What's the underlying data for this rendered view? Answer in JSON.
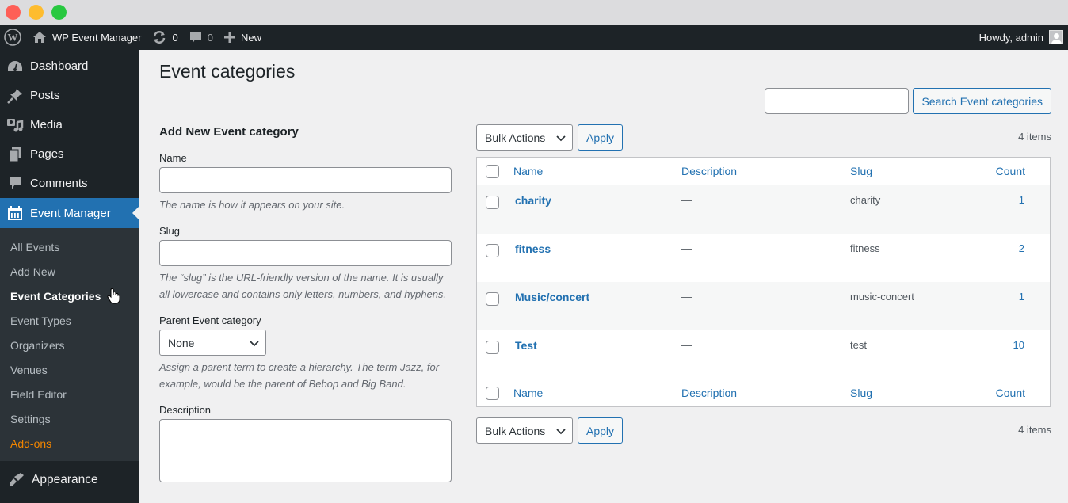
{
  "window": {
    "controls": [
      "close",
      "minimize",
      "maximize"
    ]
  },
  "adminbar": {
    "site_name": "WP Event Manager",
    "updates_count": "0",
    "comments_count": "0",
    "new_label": "New",
    "greeting": "Howdy, admin"
  },
  "sidebar": {
    "items": [
      {
        "label": "Dashboard",
        "icon": "dashboard-icon"
      },
      {
        "label": "Posts",
        "icon": "pin-icon"
      },
      {
        "label": "Media",
        "icon": "media-icon"
      },
      {
        "label": "Pages",
        "icon": "pages-icon"
      },
      {
        "label": "Comments",
        "icon": "comment-icon"
      },
      {
        "label": "Event Manager",
        "icon": "calendar-icon",
        "active": true
      }
    ],
    "submenu": [
      {
        "label": "All Events"
      },
      {
        "label": "Add New"
      },
      {
        "label": "Event Categories",
        "current": true
      },
      {
        "label": "Event Types"
      },
      {
        "label": "Organizers"
      },
      {
        "label": "Venues"
      },
      {
        "label": "Field Editor"
      },
      {
        "label": "Settings"
      },
      {
        "label": "Add-ons",
        "color": "#f18500"
      }
    ],
    "after": [
      {
        "label": "Appearance",
        "icon": "paintbrush-icon"
      }
    ]
  },
  "page": {
    "title": "Event categories",
    "search": {
      "value": "",
      "button": "Search Event categories"
    }
  },
  "form": {
    "heading": "Add New Event category",
    "name": {
      "label": "Name",
      "value": "",
      "hint": "The name is how it appears on your site."
    },
    "slug": {
      "label": "Slug",
      "value": "",
      "hint": "The “slug” is the URL-friendly version of the name. It is usually all lowercase and contains only letters, numbers, and hyphens."
    },
    "parent": {
      "label": "Parent Event category",
      "selected": "None",
      "hint": "Assign a parent term to create a hierarchy. The term Jazz, for example, would be the parent of Bebop and Big Band."
    },
    "description": {
      "label": "Description",
      "value": ""
    }
  },
  "table": {
    "bulk_actions": "Bulk Actions",
    "apply": "Apply",
    "items_count": "4 items",
    "columns": {
      "name": "Name",
      "description": "Description",
      "slug": "Slug",
      "count": "Count"
    },
    "rows": [
      {
        "name": "charity",
        "description": "—",
        "slug": "charity",
        "count": "1"
      },
      {
        "name": "fitness",
        "description": "—",
        "slug": "fitness",
        "count": "2"
      },
      {
        "name": "Music/concert",
        "description": "—",
        "slug": "music-concert",
        "count": "1"
      },
      {
        "name": "Test",
        "description": "—",
        "slug": "test",
        "count": "10"
      }
    ]
  },
  "colors": {
    "accent": "#2271b1",
    "adminbar_bg": "#1d2327",
    "submenu_bg": "#2c3338",
    "addons": "#f18500",
    "page_bg": "#f0f0f1"
  }
}
